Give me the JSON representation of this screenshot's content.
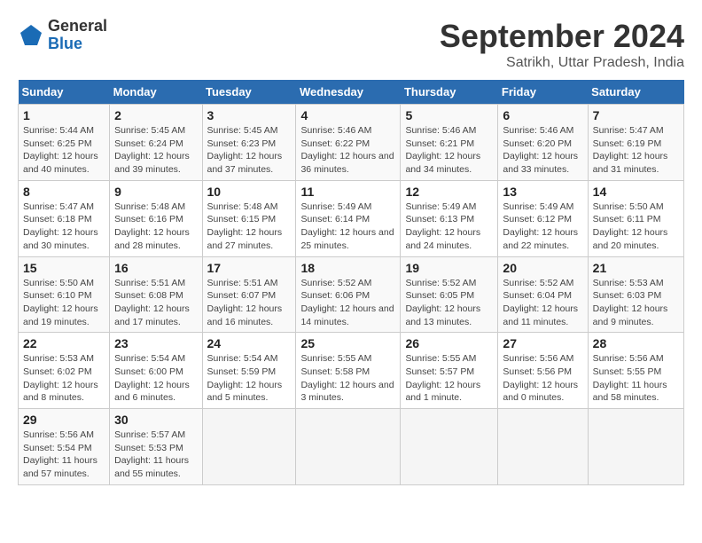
{
  "header": {
    "logo_general": "General",
    "logo_blue": "Blue",
    "month_title": "September 2024",
    "subtitle": "Satrikh, Uttar Pradesh, India"
  },
  "columns": [
    "Sunday",
    "Monday",
    "Tuesday",
    "Wednesday",
    "Thursday",
    "Friday",
    "Saturday"
  ],
  "weeks": [
    [
      {
        "day": "1",
        "sunrise": "Sunrise: 5:44 AM",
        "sunset": "Sunset: 6:25 PM",
        "daylight": "Daylight: 12 hours and 40 minutes."
      },
      {
        "day": "2",
        "sunrise": "Sunrise: 5:45 AM",
        "sunset": "Sunset: 6:24 PM",
        "daylight": "Daylight: 12 hours and 39 minutes."
      },
      {
        "day": "3",
        "sunrise": "Sunrise: 5:45 AM",
        "sunset": "Sunset: 6:23 PM",
        "daylight": "Daylight: 12 hours and 37 minutes."
      },
      {
        "day": "4",
        "sunrise": "Sunrise: 5:46 AM",
        "sunset": "Sunset: 6:22 PM",
        "daylight": "Daylight: 12 hours and 36 minutes."
      },
      {
        "day": "5",
        "sunrise": "Sunrise: 5:46 AM",
        "sunset": "Sunset: 6:21 PM",
        "daylight": "Daylight: 12 hours and 34 minutes."
      },
      {
        "day": "6",
        "sunrise": "Sunrise: 5:46 AM",
        "sunset": "Sunset: 6:20 PM",
        "daylight": "Daylight: 12 hours and 33 minutes."
      },
      {
        "day": "7",
        "sunrise": "Sunrise: 5:47 AM",
        "sunset": "Sunset: 6:19 PM",
        "daylight": "Daylight: 12 hours and 31 minutes."
      }
    ],
    [
      {
        "day": "8",
        "sunrise": "Sunrise: 5:47 AM",
        "sunset": "Sunset: 6:18 PM",
        "daylight": "Daylight: 12 hours and 30 minutes."
      },
      {
        "day": "9",
        "sunrise": "Sunrise: 5:48 AM",
        "sunset": "Sunset: 6:16 PM",
        "daylight": "Daylight: 12 hours and 28 minutes."
      },
      {
        "day": "10",
        "sunrise": "Sunrise: 5:48 AM",
        "sunset": "Sunset: 6:15 PM",
        "daylight": "Daylight: 12 hours and 27 minutes."
      },
      {
        "day": "11",
        "sunrise": "Sunrise: 5:49 AM",
        "sunset": "Sunset: 6:14 PM",
        "daylight": "Daylight: 12 hours and 25 minutes."
      },
      {
        "day": "12",
        "sunrise": "Sunrise: 5:49 AM",
        "sunset": "Sunset: 6:13 PM",
        "daylight": "Daylight: 12 hours and 24 minutes."
      },
      {
        "day": "13",
        "sunrise": "Sunrise: 5:49 AM",
        "sunset": "Sunset: 6:12 PM",
        "daylight": "Daylight: 12 hours and 22 minutes."
      },
      {
        "day": "14",
        "sunrise": "Sunrise: 5:50 AM",
        "sunset": "Sunset: 6:11 PM",
        "daylight": "Daylight: 12 hours and 20 minutes."
      }
    ],
    [
      {
        "day": "15",
        "sunrise": "Sunrise: 5:50 AM",
        "sunset": "Sunset: 6:10 PM",
        "daylight": "Daylight: 12 hours and 19 minutes."
      },
      {
        "day": "16",
        "sunrise": "Sunrise: 5:51 AM",
        "sunset": "Sunset: 6:08 PM",
        "daylight": "Daylight: 12 hours and 17 minutes."
      },
      {
        "day": "17",
        "sunrise": "Sunrise: 5:51 AM",
        "sunset": "Sunset: 6:07 PM",
        "daylight": "Daylight: 12 hours and 16 minutes."
      },
      {
        "day": "18",
        "sunrise": "Sunrise: 5:52 AM",
        "sunset": "Sunset: 6:06 PM",
        "daylight": "Daylight: 12 hours and 14 minutes."
      },
      {
        "day": "19",
        "sunrise": "Sunrise: 5:52 AM",
        "sunset": "Sunset: 6:05 PM",
        "daylight": "Daylight: 12 hours and 13 minutes."
      },
      {
        "day": "20",
        "sunrise": "Sunrise: 5:52 AM",
        "sunset": "Sunset: 6:04 PM",
        "daylight": "Daylight: 12 hours and 11 minutes."
      },
      {
        "day": "21",
        "sunrise": "Sunrise: 5:53 AM",
        "sunset": "Sunset: 6:03 PM",
        "daylight": "Daylight: 12 hours and 9 minutes."
      }
    ],
    [
      {
        "day": "22",
        "sunrise": "Sunrise: 5:53 AM",
        "sunset": "Sunset: 6:02 PM",
        "daylight": "Daylight: 12 hours and 8 minutes."
      },
      {
        "day": "23",
        "sunrise": "Sunrise: 5:54 AM",
        "sunset": "Sunset: 6:00 PM",
        "daylight": "Daylight: 12 hours and 6 minutes."
      },
      {
        "day": "24",
        "sunrise": "Sunrise: 5:54 AM",
        "sunset": "Sunset: 5:59 PM",
        "daylight": "Daylight: 12 hours and 5 minutes."
      },
      {
        "day": "25",
        "sunrise": "Sunrise: 5:55 AM",
        "sunset": "Sunset: 5:58 PM",
        "daylight": "Daylight: 12 hours and 3 minutes."
      },
      {
        "day": "26",
        "sunrise": "Sunrise: 5:55 AM",
        "sunset": "Sunset: 5:57 PM",
        "daylight": "Daylight: 12 hours and 1 minute."
      },
      {
        "day": "27",
        "sunrise": "Sunrise: 5:56 AM",
        "sunset": "Sunset: 5:56 PM",
        "daylight": "Daylight: 12 hours and 0 minutes."
      },
      {
        "day": "28",
        "sunrise": "Sunrise: 5:56 AM",
        "sunset": "Sunset: 5:55 PM",
        "daylight": "Daylight: 11 hours and 58 minutes."
      }
    ],
    [
      {
        "day": "29",
        "sunrise": "Sunrise: 5:56 AM",
        "sunset": "Sunset: 5:54 PM",
        "daylight": "Daylight: 11 hours and 57 minutes."
      },
      {
        "day": "30",
        "sunrise": "Sunrise: 5:57 AM",
        "sunset": "Sunset: 5:53 PM",
        "daylight": "Daylight: 11 hours and 55 minutes."
      },
      null,
      null,
      null,
      null,
      null
    ]
  ]
}
